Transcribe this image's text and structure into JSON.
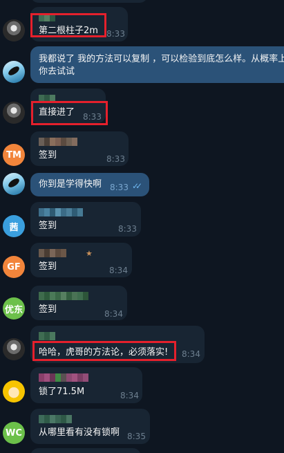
{
  "messages": [
    {
      "sender": "",
      "text": "第二根柱子2m",
      "time": "8:33",
      "highlighted": true
    },
    {
      "sender": "",
      "text_lines": [
        "我都说了 我的方法可以复制 ，可以检验到底怎么样。从概率上",
        "你去试试"
      ],
      "outgoing": true
    },
    {
      "sender": "",
      "text": "直接进了",
      "time": "8:33",
      "highlighted": true
    },
    {
      "avatar_label": "TM",
      "sender": "",
      "text": "签到",
      "time": "8:33"
    },
    {
      "text": "你到是学得快啊",
      "time": "8:33",
      "outgoing": true,
      "read": true
    },
    {
      "avatar_label": "茜",
      "sender": "",
      "text": "签到",
      "time": "8:33"
    },
    {
      "avatar_label": "GF",
      "sender": "",
      "text": "签到",
      "time": "8:34"
    },
    {
      "avatar_label": "优东",
      "sender": "",
      "text": "签到",
      "time": "8:34"
    },
    {
      "sender": "",
      "text": "哈哈，虎哥的方法论，必须落实!",
      "time": "8:34",
      "highlighted": true
    },
    {
      "sender": "",
      "text": "锁了71.5M",
      "time": "8:34"
    },
    {
      "avatar_label": "WC",
      "sender": "",
      "text": "从哪里看有没有锁啊",
      "time": "8:35"
    }
  ],
  "colors": {
    "background": "#0e1621",
    "incoming_bubble": "#182533",
    "outgoing_bubble": "#2b5278",
    "highlight": "#e5202c",
    "avatar_tm": "#f2853b",
    "avatar_xi": "#3a9fde",
    "avatar_gf": "#f2853b",
    "avatar_youdong": "#6cc04a",
    "avatar_wc": "#6cc04a"
  }
}
